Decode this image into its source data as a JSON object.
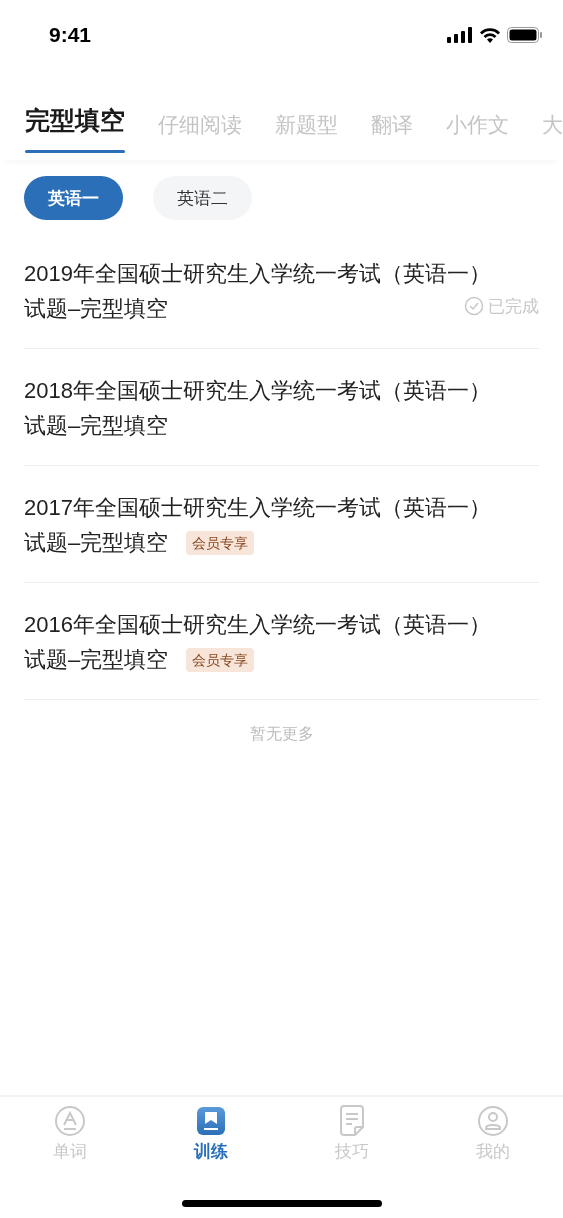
{
  "status_bar": {
    "time": "9:41"
  },
  "tabs": [
    {
      "label": "完型填空",
      "selected": true
    },
    {
      "label": "仔细阅读",
      "selected": false
    },
    {
      "label": "新题型",
      "selected": false
    },
    {
      "label": "翻译",
      "selected": false
    },
    {
      "label": "小作文",
      "selected": false
    },
    {
      "label": "大",
      "selected": false
    }
  ],
  "filters": [
    {
      "label": "英语一",
      "selected": true
    },
    {
      "label": "英语二",
      "selected": false
    }
  ],
  "items": [
    {
      "title_lines": [
        "2019年全国硕士研究生入学统一考试（英语一）",
        "试题–完型填空"
      ],
      "completed": true,
      "status": "已完成"
    },
    {
      "title_lines": [
        "2018年全国硕士研究生入学统一考试（英语一）",
        "试题–完型填空"
      ],
      "completed": false
    },
    {
      "title_lines": [
        "2017年全国硕士研究生入学统一考试（英语一）",
        "试题–完型填空"
      ],
      "completed": false,
      "badge": "会员专享"
    },
    {
      "title_lines": [
        "2016年全国硕士研究生入学统一考试（英语一）",
        "试题–完型填空"
      ],
      "completed": false,
      "badge": "会员专享"
    }
  ],
  "footer": "暂无更多",
  "bottom_nav": [
    {
      "label": "单词",
      "selected": false
    },
    {
      "label": "训练",
      "selected": true
    },
    {
      "label": "技巧",
      "selected": false
    },
    {
      "label": "我的",
      "selected": false
    }
  ]
}
